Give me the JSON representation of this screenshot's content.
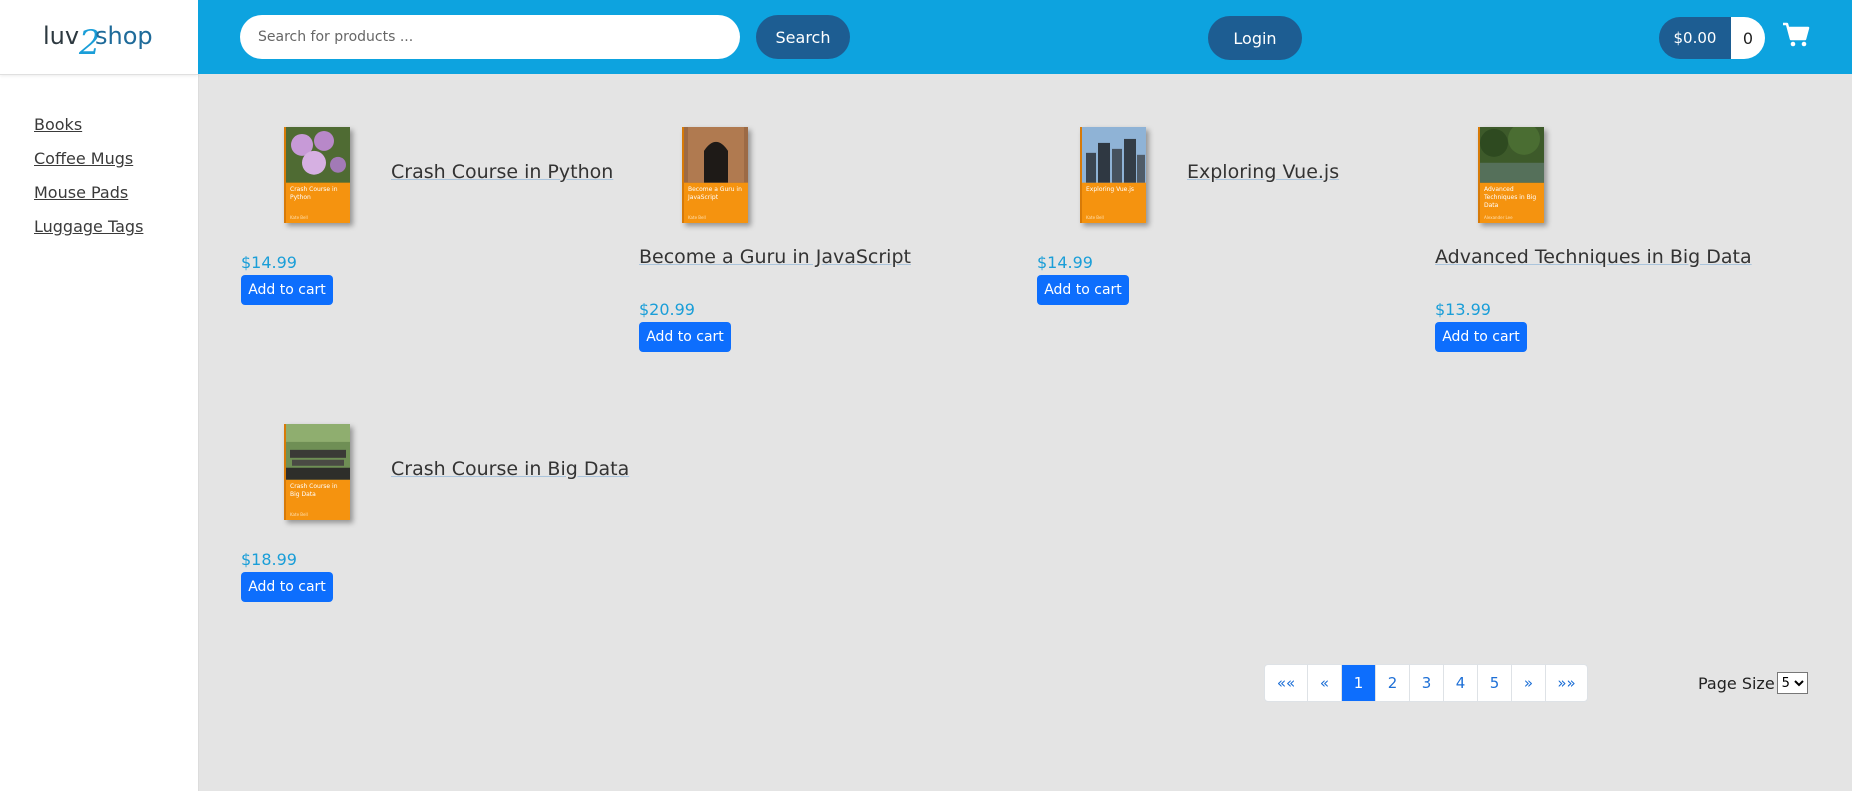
{
  "brand": {
    "logo_text_left": "luv",
    "logo_text_mark": "2",
    "logo_text_right": "shop"
  },
  "sidebar": {
    "categories": [
      {
        "label": "Books"
      },
      {
        "label": "Coffee Mugs"
      },
      {
        "label": "Mouse Pads"
      },
      {
        "label": "Luggage Tags"
      }
    ]
  },
  "header": {
    "search_placeholder": "Search for products ...",
    "search_label": "Search",
    "login_label": "Login",
    "cart_total": "$0.00",
    "cart_count": "0",
    "cart_icon": "shopping-cart-icon",
    "colors": {
      "bar": "#0da3df",
      "button": "#1d5d92"
    }
  },
  "products": [
    {
      "name": "Crash Course in Python",
      "price": "$14.99",
      "cover_title": "Crash Course in Python",
      "cover_author": "Kate Bell",
      "add_label": "Add to cart"
    },
    {
      "name": "Become a Guru in JavaScript",
      "price": "$20.99",
      "cover_title": "Become a Guru in JavaScript",
      "cover_author": "Kate Bell",
      "add_label": "Add to cart"
    },
    {
      "name": "Exploring Vue.js",
      "price": "$14.99",
      "cover_title": "Exploring Vue.js",
      "cover_author": "Kate Bell",
      "add_label": "Add to cart"
    },
    {
      "name": "Advanced Techniques in Big Data",
      "price": "$13.99",
      "cover_title": "Advanced Techniques in Big Data",
      "cover_author": "Alexander Lee",
      "add_label": "Add to cart"
    },
    {
      "name": "Crash Course in Big Data",
      "price": "$18.99",
      "cover_title": "Crash Course in Big Data",
      "cover_author": "Kate Bell",
      "add_label": "Add to cart"
    }
  ],
  "pagination": {
    "first": "««",
    "prev": "«",
    "pages": [
      "1",
      "2",
      "3",
      "4",
      "5"
    ],
    "current": "1",
    "next": "»",
    "last": "»»",
    "page_size_label": "Page Size",
    "page_size_value": "5"
  }
}
